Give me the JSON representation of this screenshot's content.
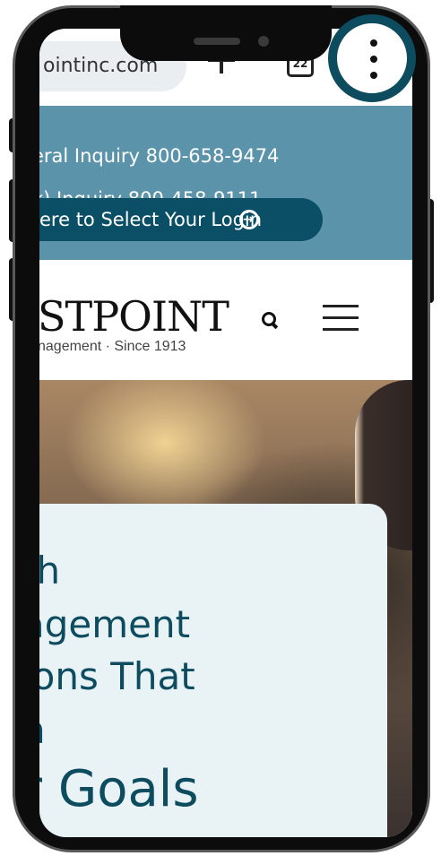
{
  "browser": {
    "url_fragment": "ointinc.com",
    "tab_count": "22"
  },
  "topbar": {
    "inquiry_general": "eral Inquiry 800-658-9474",
    "inquiry_401k": "k) Inquiry 800-458-9111",
    "login_label": "ere to Select Your Login"
  },
  "header": {
    "logo_text": "STPOINT",
    "tagline": "nagement · Since 1913"
  },
  "hero": {
    "line1": "th",
    "line2": "agement",
    "line3": "ions That",
    "line4": "h",
    "line5": "r Goals"
  },
  "colors": {
    "brand_dark": "#0b4f67",
    "topbar_bg": "#5b94aa",
    "highlight_ring": "#0d4b5f",
    "card_bg": "#e9f3f6"
  },
  "icons": [
    "plus-icon",
    "tabs-icon",
    "more-vert-icon",
    "arrow-circle-icon",
    "search-icon",
    "hamburger-icon"
  ]
}
